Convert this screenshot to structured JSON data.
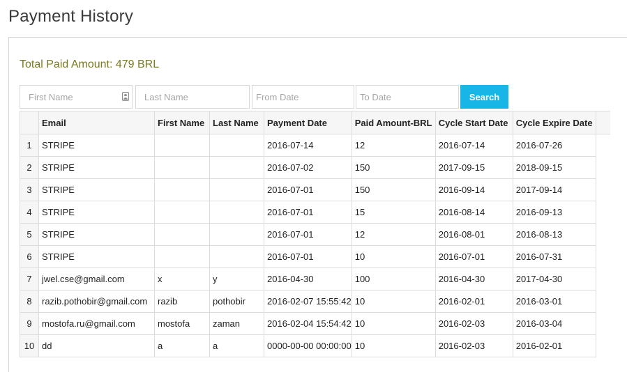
{
  "page": {
    "title": "Payment History"
  },
  "summary": {
    "total_label": "Total Paid Amount: 479 BRL"
  },
  "filters": {
    "first_name_placeholder": "First Name",
    "last_name_placeholder": "Last Name",
    "from_date_placeholder": "From Date",
    "to_date_placeholder": "To Date",
    "search_label": "Search"
  },
  "table": {
    "columns": [
      "Email",
      "First Name",
      "Last Name",
      "Payment Date",
      "Paid Amount-BRL",
      "Cycle Start Date",
      "Cycle Expire Date"
    ],
    "rows": [
      {
        "n": "1",
        "email": "STRIPE",
        "first": "",
        "last": "",
        "pay": "2016-07-14",
        "amt": "12",
        "start": "2016-07-14",
        "exp": "2016-07-26"
      },
      {
        "n": "2",
        "email": "STRIPE",
        "first": "",
        "last": "",
        "pay": "2016-07-02",
        "amt": "150",
        "start": "2017-09-15",
        "exp": "2018-09-15"
      },
      {
        "n": "3",
        "email": "STRIPE",
        "first": "",
        "last": "",
        "pay": "2016-07-01",
        "amt": "150",
        "start": "2016-09-14",
        "exp": "2017-09-14"
      },
      {
        "n": "4",
        "email": "STRIPE",
        "first": "",
        "last": "",
        "pay": "2016-07-01",
        "amt": "15",
        "start": "2016-08-14",
        "exp": "2016-09-13"
      },
      {
        "n": "5",
        "email": "STRIPE",
        "first": "",
        "last": "",
        "pay": "2016-07-01",
        "amt": "12",
        "start": "2016-08-01",
        "exp": "2016-08-13"
      },
      {
        "n": "6",
        "email": "STRIPE",
        "first": "",
        "last": "",
        "pay": "2016-07-01",
        "amt": "10",
        "start": "2016-07-01",
        "exp": "2016-07-31"
      },
      {
        "n": "7",
        "email": "jwel.cse@gmail.com",
        "first": "x",
        "last": "y",
        "pay": "2016-04-30",
        "amt": "100",
        "start": "2016-04-30",
        "exp": "2017-04-30"
      },
      {
        "n": "8",
        "email": "razib.pothobir@gmail.com",
        "first": "razib",
        "last": "pothobir",
        "pay": "2016-02-07 15:55:42",
        "amt": "10",
        "start": "2016-02-01",
        "exp": "2016-03-01"
      },
      {
        "n": "9",
        "email": "mostofa.ru@gmail.com",
        "first": "mostofa",
        "last": "zaman",
        "pay": "2016-02-04 15:54:42",
        "amt": "10",
        "start": "2016-02-03",
        "exp": "2016-03-04"
      },
      {
        "n": "10",
        "email": "dd",
        "first": "a",
        "last": "a",
        "pay": "0000-00-00 00:00:00",
        "amt": "10",
        "start": "2016-02-03",
        "exp": "2016-02-01"
      }
    ]
  }
}
